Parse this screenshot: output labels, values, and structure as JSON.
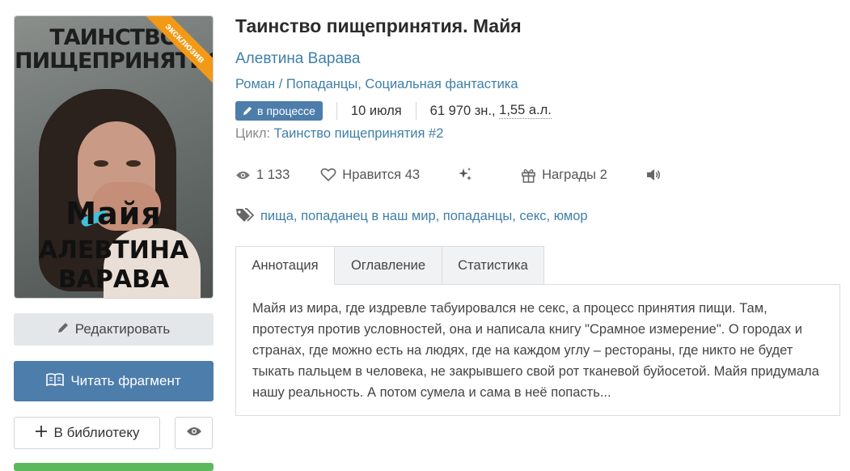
{
  "cover": {
    "title_line1": "ТАИНСТВО",
    "title_line2": "ПИЩЕПРИНЯТИЯ",
    "name": "Майя",
    "author_line1": "АЛЕВТИНА",
    "author_line2": "ВАРАВА",
    "badge": "эксклюзив",
    "badge_color": "#f29a17"
  },
  "actions": {
    "edit_label": "Редактировать",
    "read_label": "Читать фрагмент",
    "library_label": "В библиотеку",
    "edit_icon": "pencil-icon",
    "read_icon": "book-icon",
    "library_icon": "plus-icon",
    "eye_icon": "eye-icon"
  },
  "book": {
    "title": "Таинство пищепринятия. Майя",
    "author": "Алевтина Варава",
    "genre1": "Роман",
    "genre2": "Попаданцы",
    "genre3": "Социальная фантастика",
    "status": "в процессе",
    "date": "10 июля",
    "size_chars": "61 970 зн.,",
    "size_al": "1,55 а.л.",
    "cycle_label": "Цикл:",
    "cycle_name": "Таинство пищепринятия",
    "cycle_num": "#2"
  },
  "stats": {
    "views": "1 133",
    "likes_label": "Нравится",
    "likes": "43",
    "awards_label": "Награды",
    "awards": "2"
  },
  "tags": [
    "пища",
    "попаданец в наш мир",
    "попаданцы",
    "секс",
    "юмор"
  ],
  "tabs": {
    "annotation": "Аннотация",
    "contents": "Оглавление",
    "statistics": "Статистика"
  },
  "annotation": "Майя из мира, где издревле табуировался не секс, а процесс принятия пищи. Там, протестуя против условностей, она и написала книгу \"Срамное измерение\". О городах и странах, где можно есть на людях, где на каждом углу – рестораны, где никто не будет тыкать пальцем в человека, не закрывшего свой рот тканевой буйосетой. Майя придумала нашу реальность. А потом сумела и сама в неё попасть...",
  "colors": {
    "link": "#3f7fa8",
    "primary": "#4d7dab"
  }
}
